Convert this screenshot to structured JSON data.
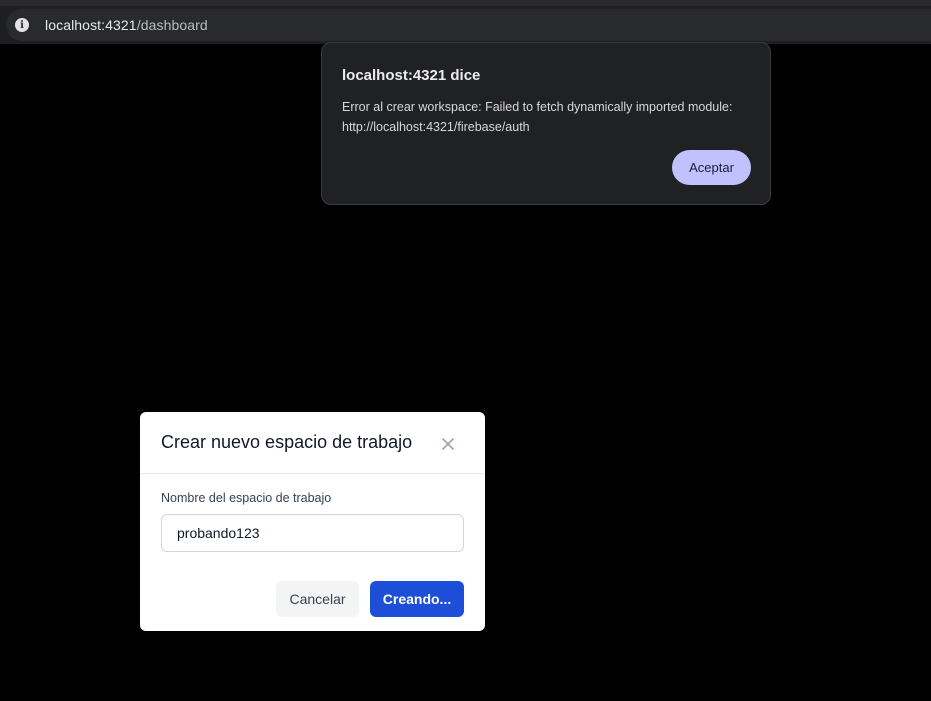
{
  "browser": {
    "info_icon": "info-icon",
    "url_host": "localhost:4321",
    "url_path": "/dashboard"
  },
  "alert": {
    "title": "localhost:4321 dice",
    "message": "Error al crear workspace: Failed to fetch dynamically imported module: http://localhost:4321/firebase/auth",
    "ok_label": "Aceptar",
    "button_color": "#c2c1ff"
  },
  "modal": {
    "title": "Crear nuevo espacio de trabajo",
    "close_icon": "close-icon",
    "field_label": "Nombre del espacio de trabajo",
    "field_value": "probando123",
    "cancel_label": "Cancelar",
    "submit_label": "Creando...",
    "primary_color": "#1d4ed8"
  }
}
